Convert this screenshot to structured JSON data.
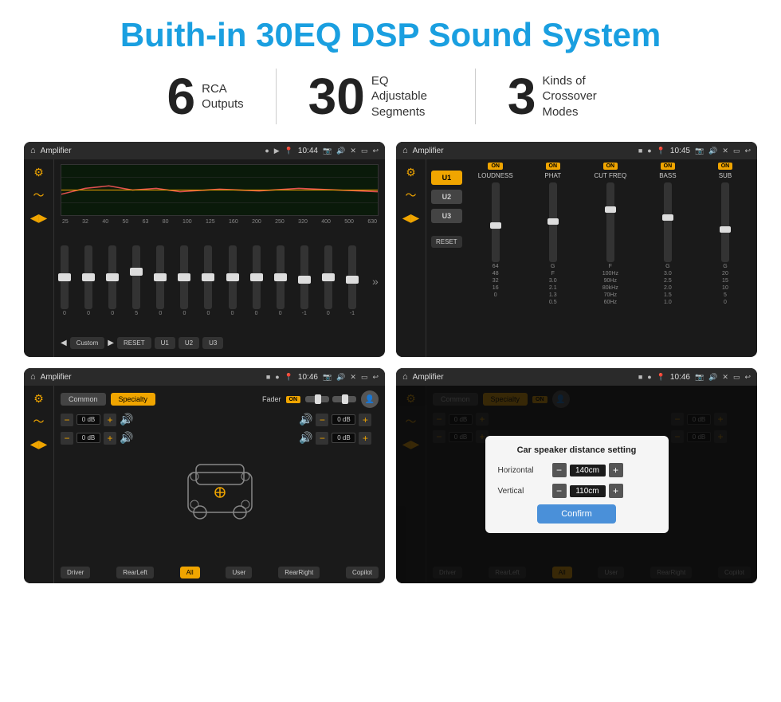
{
  "header": {
    "title": "Buith-in 30EQ DSP Sound System"
  },
  "stats": [
    {
      "number": "6",
      "label_line1": "RCA",
      "label_line2": "Outputs"
    },
    {
      "number": "30",
      "label_line1": "EQ Adjustable",
      "label_line2": "Segments"
    },
    {
      "number": "3",
      "label_line1": "Kinds of",
      "label_line2": "Crossover Modes"
    }
  ],
  "screen1": {
    "title": "Amplifier",
    "time": "10:44",
    "freq_labels": [
      "25",
      "32",
      "40",
      "50",
      "63",
      "80",
      "100",
      "125",
      "160",
      "200",
      "250",
      "320",
      "400",
      "500",
      "630"
    ],
    "slider_values": [
      "0",
      "0",
      "0",
      "5",
      "0",
      "0",
      "0",
      "0",
      "0",
      "0",
      "0",
      "-1",
      "0",
      "-1"
    ],
    "buttons": [
      "Custom",
      "RESET",
      "U1",
      "U2",
      "U3"
    ]
  },
  "screen2": {
    "title": "Amplifier",
    "time": "10:45",
    "u_buttons": [
      "U1",
      "U2",
      "U3"
    ],
    "controls": [
      {
        "label": "LOUDNESS",
        "on": true
      },
      {
        "label": "PHAT",
        "on": true
      },
      {
        "label": "CUT FREQ",
        "on": true
      },
      {
        "label": "BASS",
        "on": true
      },
      {
        "label": "SUB",
        "on": true
      }
    ],
    "reset_label": "RESET"
  },
  "screen3": {
    "title": "Amplifier",
    "time": "10:46",
    "tabs": [
      "Common",
      "Specialty"
    ],
    "fader_label": "Fader",
    "fader_on": "ON",
    "db_values": [
      "0 dB",
      "0 dB",
      "0 dB",
      "0 dB"
    ],
    "bottom_buttons": [
      "Driver",
      "RearLeft",
      "All",
      "User",
      "RearRight",
      "Copilot"
    ]
  },
  "screen4": {
    "title": "Amplifier",
    "time": "10:46",
    "tabs": [
      "Common",
      "Specialty"
    ],
    "dialog": {
      "title": "Car speaker distance setting",
      "horizontal_label": "Horizontal",
      "horizontal_value": "140cm",
      "vertical_label": "Vertical",
      "vertical_value": "110cm",
      "confirm_label": "Confirm"
    },
    "db_values": [
      "0 dB",
      "0 dB"
    ],
    "bottom_buttons": [
      "Driver",
      "RearLeft",
      "All",
      "User",
      "RearRight",
      "Copilot"
    ]
  }
}
